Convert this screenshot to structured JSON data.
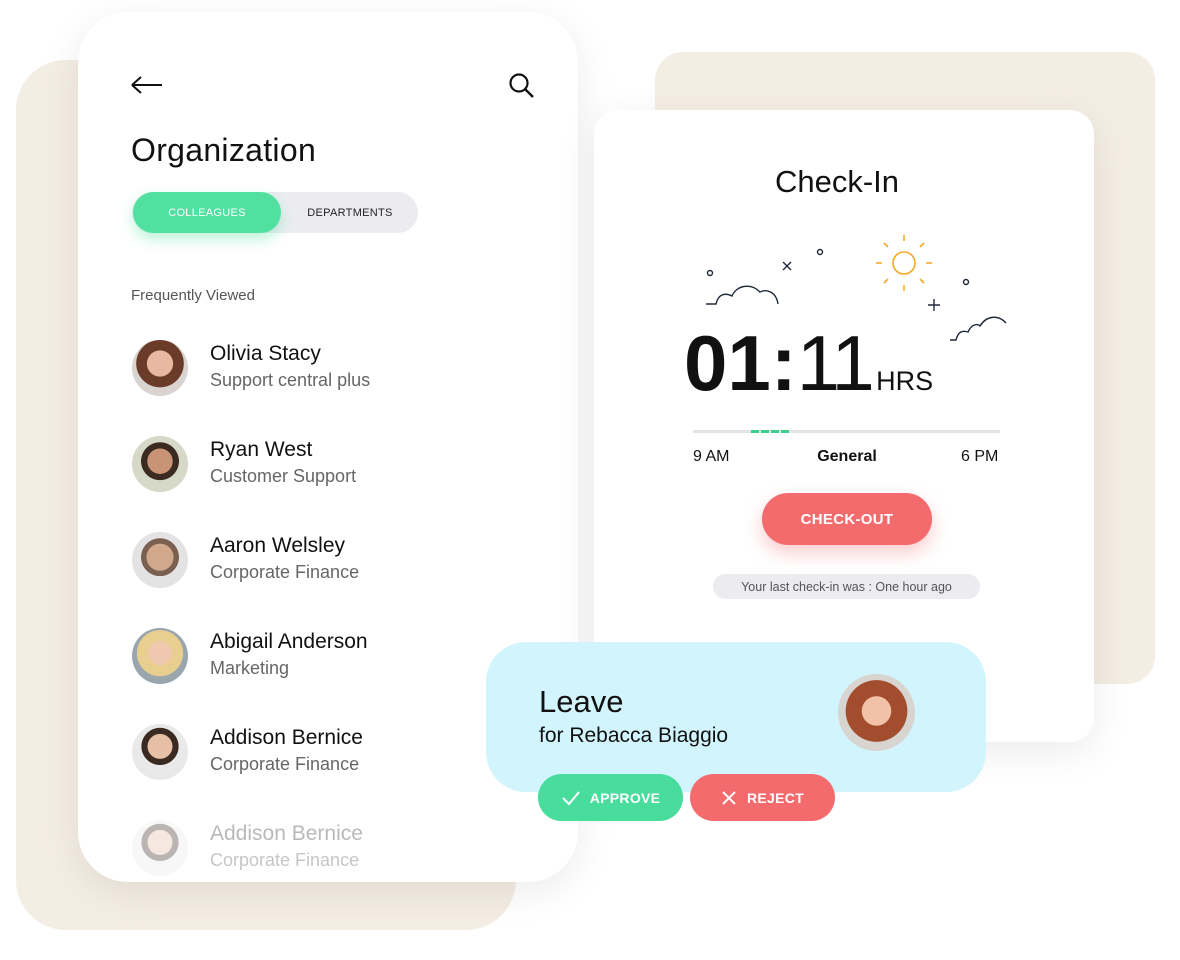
{
  "organization": {
    "title": "Organization",
    "tabs": [
      {
        "label": "COLLEAGUES",
        "active": true
      },
      {
        "label": "DEPARTMENTS",
        "active": false
      }
    ],
    "section_label": "Frequently Viewed",
    "people": [
      {
        "name": "Olivia Stacy",
        "role": "Support central plus"
      },
      {
        "name": "Ryan West",
        "role": "Customer Support"
      },
      {
        "name": "Aaron Welsley",
        "role": "Corporate Finance"
      },
      {
        "name": "Abigail Anderson",
        "role": "Marketing"
      },
      {
        "name": "Addison Bernice",
        "role": "Corporate Finance"
      },
      {
        "name": "Addison Bernice",
        "role": "Corporate Finance"
      }
    ]
  },
  "checkin": {
    "title": "Check-In",
    "hours": "01:",
    "minutes": "11",
    "unit": "HRS",
    "start": "9 AM",
    "shift": "General",
    "end": "6 PM",
    "checkout_label": "CHECK-OUT",
    "last_checkin": "Your last check-in was : One hour ago"
  },
  "leave": {
    "title": "Leave",
    "subtitle": "for Rebacca Biaggio",
    "approve_label": "APPROVE",
    "reject_label": "REJECT"
  },
  "colors": {
    "green": "#52e0a0",
    "red": "#f46b6e",
    "beige": "#f4ede3",
    "leave_bg": "#d2f5fd",
    "sun": "#f5a623"
  }
}
